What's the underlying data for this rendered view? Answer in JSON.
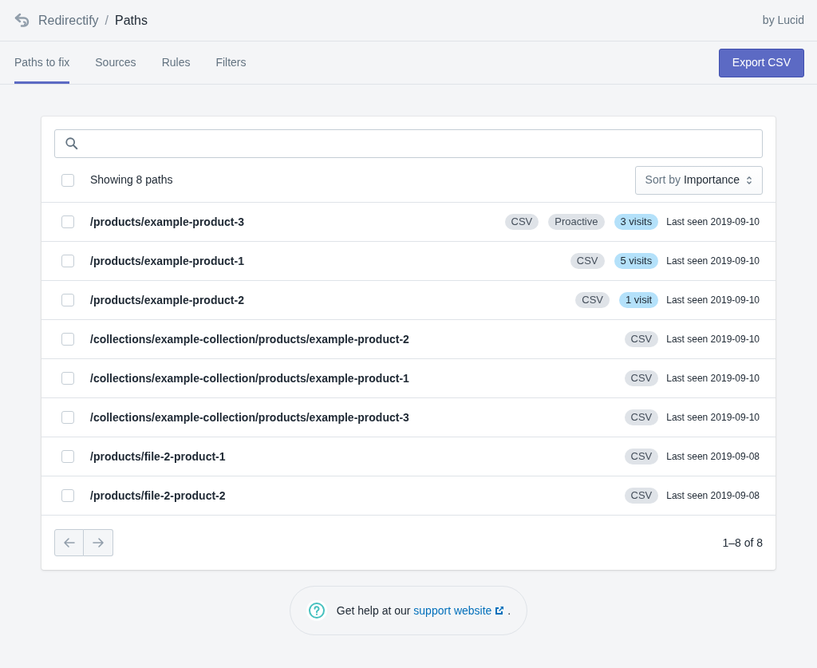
{
  "header": {
    "app": "Redirectify",
    "separator": "/",
    "page": "Paths",
    "byline": "by Lucid"
  },
  "tabs": [
    {
      "label": "Paths to fix",
      "selected": true
    },
    {
      "label": "Sources",
      "selected": false
    },
    {
      "label": "Rules",
      "selected": false
    },
    {
      "label": "Filters",
      "selected": false
    }
  ],
  "export_button": "Export CSV",
  "list_header": {
    "checked": false,
    "summary": "Showing 8 paths",
    "sort_label": "Sort by",
    "sort_value": "Importance"
  },
  "rows": [
    {
      "checked": false,
      "path": "/products/example-product-3",
      "tags": [
        {
          "kind": "source",
          "label": "CSV"
        },
        {
          "kind": "source",
          "label": "Proactive"
        },
        {
          "kind": "visits",
          "label": "3 visits"
        }
      ],
      "last_seen": "Last seen 2019-09-10"
    },
    {
      "checked": false,
      "path": "/products/example-product-1",
      "tags": [
        {
          "kind": "source",
          "label": "CSV"
        },
        {
          "kind": "visits",
          "label": "5 visits"
        }
      ],
      "last_seen": "Last seen 2019-09-10"
    },
    {
      "checked": false,
      "path": "/products/example-product-2",
      "tags": [
        {
          "kind": "source",
          "label": "CSV"
        },
        {
          "kind": "visits",
          "label": "1 visit"
        }
      ],
      "last_seen": "Last seen 2019-09-10"
    },
    {
      "checked": false,
      "path": "/collections/example-collection/products/example-product-2",
      "tags": [
        {
          "kind": "source",
          "label": "CSV"
        }
      ],
      "last_seen": "Last seen 2019-09-10"
    },
    {
      "checked": false,
      "path": "/collections/example-collection/products/example-product-1",
      "tags": [
        {
          "kind": "source",
          "label": "CSV"
        }
      ],
      "last_seen": "Last seen 2019-09-10"
    },
    {
      "checked": false,
      "path": "/collections/example-collection/products/example-product-3",
      "tags": [
        {
          "kind": "source",
          "label": "CSV"
        }
      ],
      "last_seen": "Last seen 2019-09-10"
    },
    {
      "checked": false,
      "path": "/products/file-2-product-1",
      "tags": [
        {
          "kind": "source",
          "label": "CSV"
        }
      ],
      "last_seen": "Last seen 2019-09-08"
    },
    {
      "checked": false,
      "path": "/products/file-2-product-2",
      "tags": [
        {
          "kind": "source",
          "label": "CSV"
        }
      ],
      "last_seen": "Last seen 2019-09-08"
    }
  ],
  "pagination": {
    "previous_disabled": true,
    "next_disabled": true,
    "range": "1–8 of 8"
  },
  "help": {
    "prefix": "Get help at our",
    "link": "support website",
    "suffix": "."
  }
}
